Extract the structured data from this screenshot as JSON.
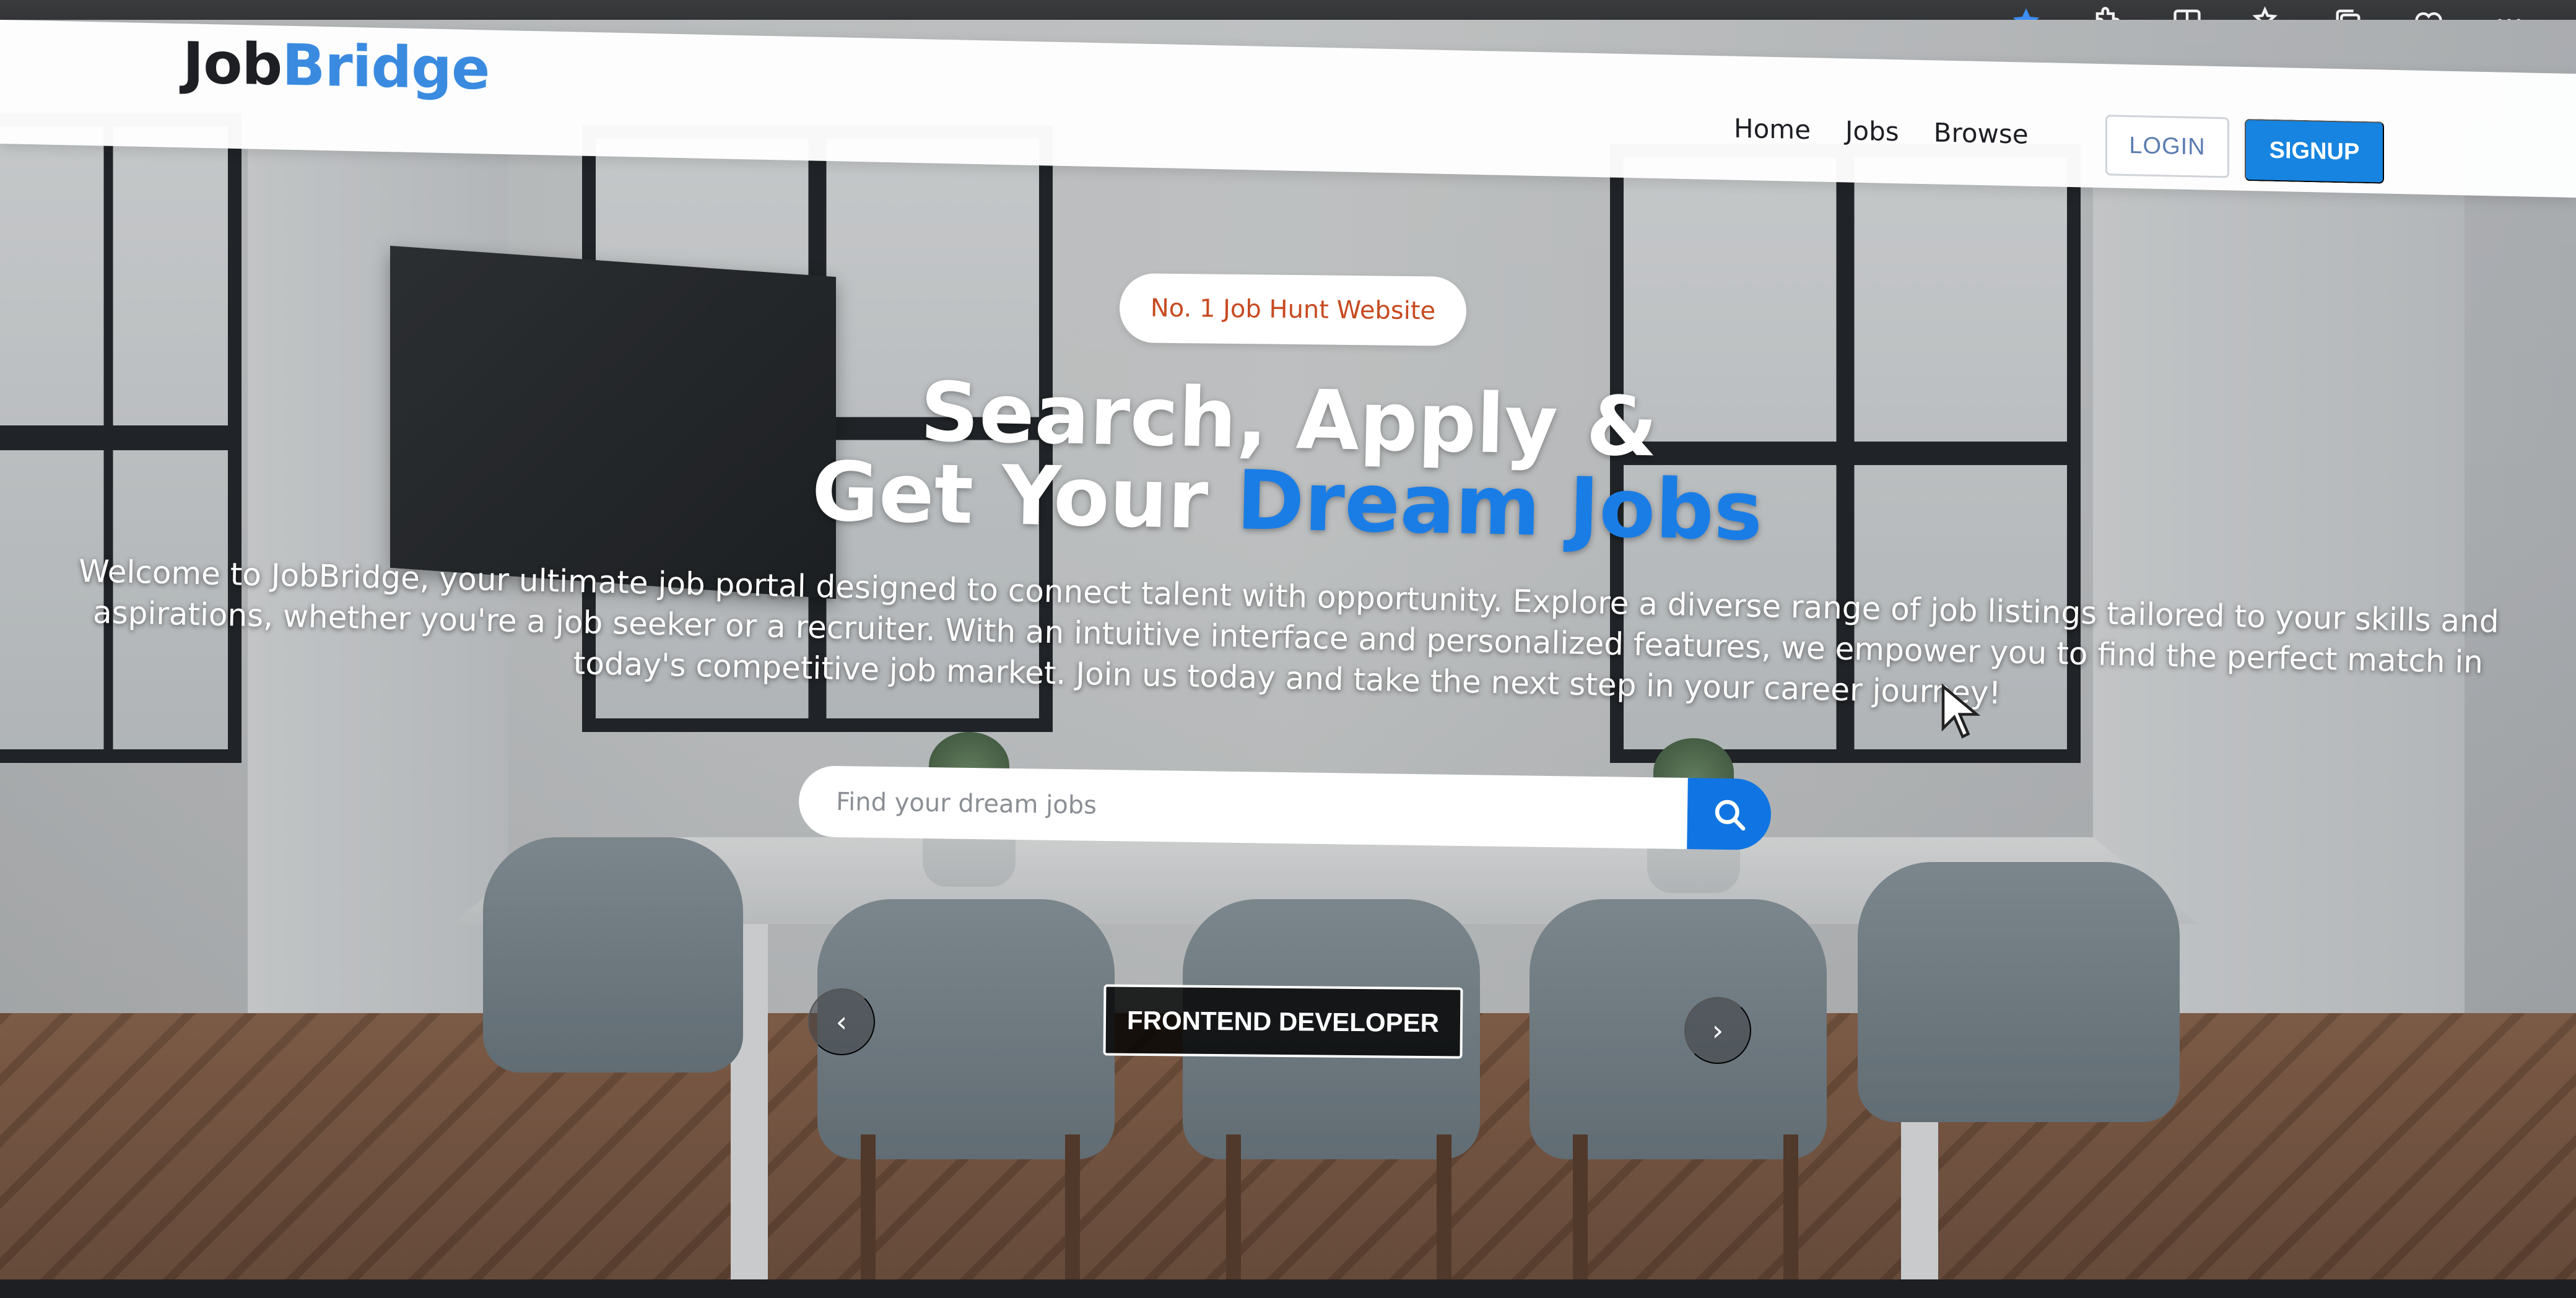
{
  "browser": {
    "icons": [
      "star-icon",
      "extensions-icon",
      "split-screen-icon",
      "favorites-icon",
      "collections-icon",
      "heart-icon",
      "more-icon"
    ]
  },
  "navbar": {
    "logo_part1": "Job",
    "logo_part2": "Bridge",
    "links": [
      "Home",
      "Jobs",
      "Browse"
    ],
    "login_label": "LOGIN",
    "signup_label": "SIGNUP"
  },
  "hero": {
    "badge": "No. 1 Job Hunt Website",
    "headline_line1": "Search, Apply &",
    "headline_line2_prefix": "Get Your ",
    "headline_line2_accent": "Dream Jobs",
    "description": "Welcome to JobBridge, your ultimate job portal designed to connect talent with opportunity. Explore a diverse range of job listings tailored to your skills and aspirations, whether you're a job seeker or a recruiter. With an intuitive interface and personalized features, we empower you to find the perfect match in today's competitive job market. Join us today and take the next step in your career journey!"
  },
  "search": {
    "placeholder": "Find your dream jobs",
    "value": ""
  },
  "carousel": {
    "current_item": "FRONTEND DEVELOPER"
  },
  "colors": {
    "accent": "#1a7de6",
    "signup_bg": "#1684e0",
    "badge_text": "#c74a20",
    "logo_blue": "#3a8be0"
  }
}
